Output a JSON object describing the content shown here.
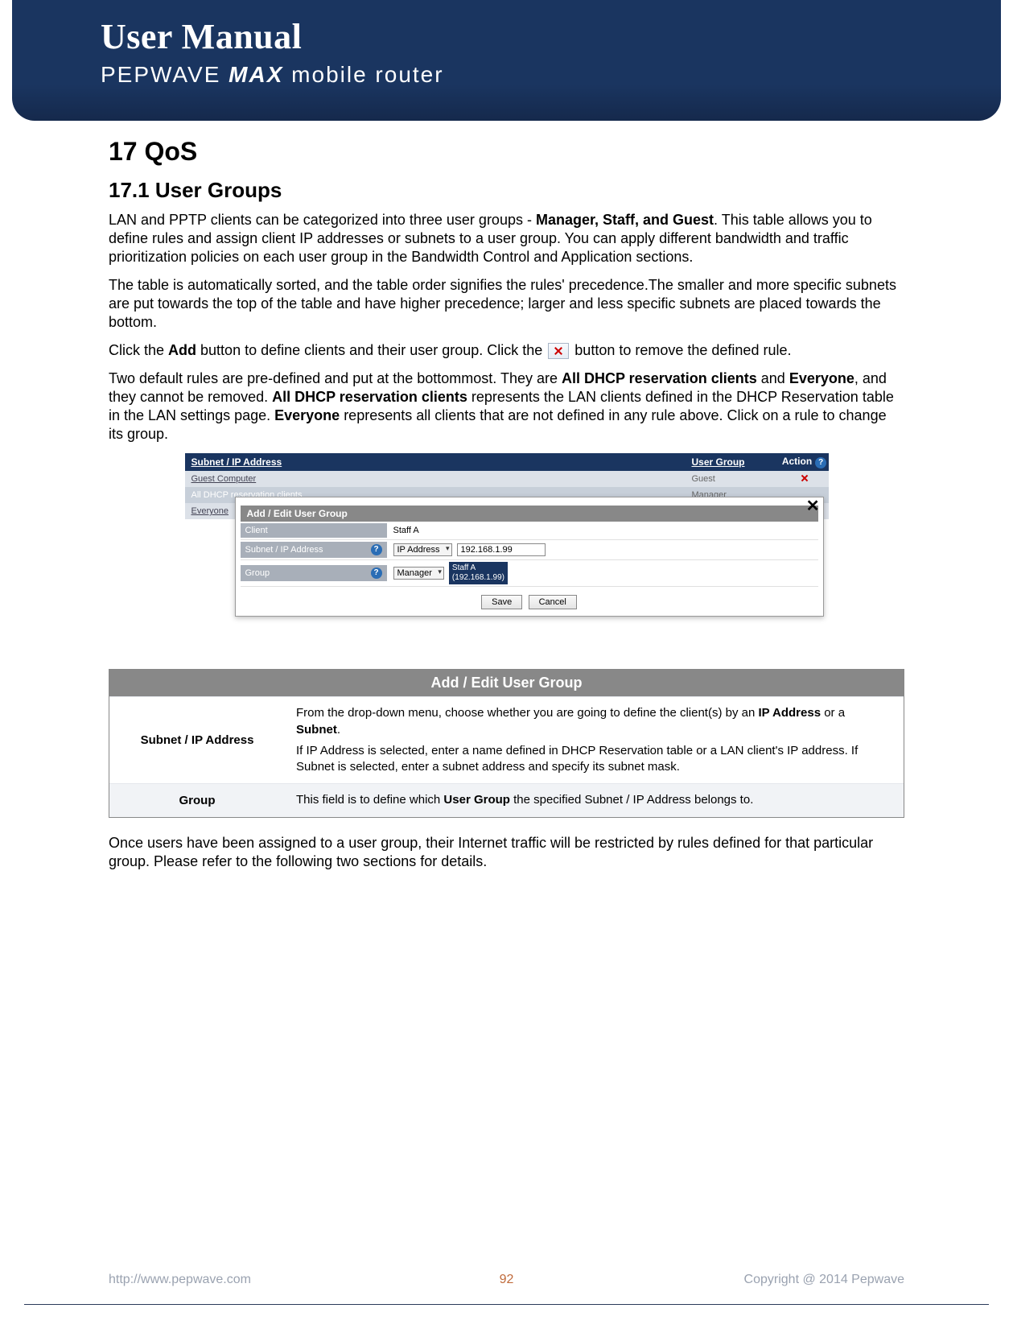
{
  "header": {
    "title": "User Manual",
    "subtitle_brand": "PEPWAVE",
    "subtitle_product": "MAX",
    "subtitle_rest": "mobile router"
  },
  "section": {
    "number_title": "17   QoS",
    "sub_number_title": "17.1   User Groups"
  },
  "paragraphs": {
    "p1_a": "LAN and PPTP clients can be categorized into three user groups - ",
    "p1_bold": "Manager, Staff, and Guest",
    "p1_b": ". This table allows you to define rules and assign client IP addresses or subnets to a user group. You can apply different bandwidth and traffic prioritization policies on each user group in the Bandwidth Control and Application sections.",
    "p2": "The table is automatically sorted, and the table order signifies the rules' precedence.The smaller and more specific subnets are put towards the top of the table and have higher precedence; larger and less specific subnets are placed towards the bottom.",
    "p3_a": "Click the ",
    "p3_bold1": "Add",
    "p3_b": " button to define clients and their user group. Click the ",
    "p3_c": " button to remove the defined rule.",
    "p4_a": "Two default rules are pre-defined and put at the bottommost. They are ",
    "p4_bold1": "All DHCP reservation clients",
    "p4_b": " and ",
    "p4_bold2": "Everyone",
    "p4_c": ", and they cannot be removed. ",
    "p4_bold3": "All DHCP reservation clients",
    "p4_d": " represents the LAN clients defined in the DHCP Reservation table in the LAN settings page. ",
    "p4_bold4": "Everyone",
    "p4_e": " represents all clients that are not defined in any rule above.  Click on a rule to change its group.",
    "p5": "Once users have been assigned to a user group, their Internet traffic will be restricted by rules defined for that particular group. Please refer to the following two sections for details."
  },
  "screenshot": {
    "header": {
      "col1": "Subnet / IP Address",
      "col2": "User Group",
      "col3": "Action"
    },
    "rows": [
      {
        "name": "Guest Computer",
        "group": "Guest",
        "deletable": true
      },
      {
        "name": "All DHCP reservation clients",
        "group": "Manager",
        "deletable": false
      },
      {
        "name": "Everyone",
        "group": "",
        "deletable": false
      }
    ],
    "popup": {
      "title": "Add / Edit User Group",
      "client_label": "Client",
      "client_value": "Staff A",
      "subnet_label": "Subnet / IP Address",
      "subnet_type": "IP Address",
      "subnet_value": "192.168.1.99",
      "group_label": "Group",
      "group_value": "Manager",
      "tooltip_line1": "Staff A",
      "tooltip_line2": "(192.168.1.99)",
      "save": "Save",
      "cancel": "Cancel"
    }
  },
  "desc_table": {
    "title": "Add / Edit User Group",
    "rows": [
      {
        "k": "Subnet / IP Address",
        "v_a": "From the drop-down menu, choose whether you are going to define the client(s) by an ",
        "v_bold1": "IP Address",
        "v_b": " or a ",
        "v_bold2": "Subnet",
        "v_c": ".",
        "v_d": "If IP Address is selected, enter a name defined in DHCP Reservation table or a LAN client's IP address. If Subnet is selected, enter a subnet address and specify its subnet mask."
      },
      {
        "k": "Group",
        "v_a": "This field is to define which ",
        "v_bold1": "User Group",
        "v_b": " the specified Subnet / IP Address belongs to."
      }
    ]
  },
  "footer": {
    "url": "http://www.pepwave.com",
    "page": "92",
    "copyright": "Copyright @ 2014 Pepwave"
  }
}
